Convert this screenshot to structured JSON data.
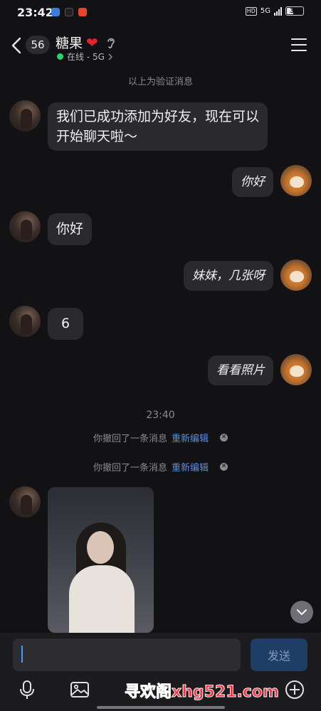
{
  "status_bar": {
    "time": "23:42",
    "network": "5G",
    "hd": "HD",
    "battery": "37"
  },
  "header": {
    "unread_count": "56",
    "title": "糖果",
    "heart": "❤",
    "status": "在线 - 5G",
    "icons": [
      "back-chevron-icon",
      "ear-icon",
      "menu-icon"
    ]
  },
  "chat": {
    "verify_notice": "以上为验证消息",
    "messages": [
      {
        "side": "left",
        "text": "我们已成功添加为好友，现在可以开始聊天啦～"
      },
      {
        "side": "right",
        "text": "你好"
      },
      {
        "side": "left",
        "text": "你好"
      },
      {
        "side": "right",
        "text": "妹妹，几张呀"
      },
      {
        "side": "left",
        "text": "6"
      },
      {
        "side": "right",
        "text": "看看照片"
      }
    ],
    "time_divider": "23:40",
    "recall_text": "你撤回了一条消息",
    "recall_edit": "重新编辑"
  },
  "input": {
    "value": "",
    "send_label": "发送"
  },
  "toolbar": {
    "icons": [
      "microphone-icon",
      "image-icon",
      "plus-icon"
    ]
  },
  "watermark": "寻欢阁xhg521.com"
}
